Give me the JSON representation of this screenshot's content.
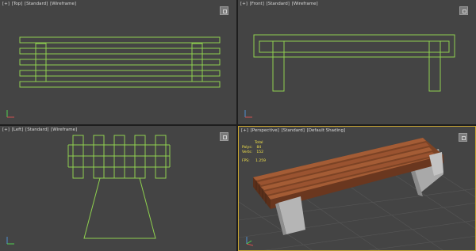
{
  "viewports": {
    "top": {
      "label_parts": [
        "[+]",
        "[Top]",
        "[Standard]",
        "[Wireframe]"
      ]
    },
    "front": {
      "label_parts": [
        "[+]",
        "[Front]",
        "[Standard]",
        "[Wireframe]"
      ]
    },
    "left": {
      "label_parts": [
        "[+]",
        "[Left]",
        "[Standard]",
        "[Wireframe]"
      ]
    },
    "perspective": {
      "label_parts": [
        "[+]",
        "[Perspective]",
        "[Standard]",
        "[Default Shading]"
      ],
      "stats": {
        "total_label": "Total",
        "polys_label": "Polys:",
        "polys_value": "84",
        "verts_label": "Verts:",
        "verts_value": "152",
        "fps_label": "FPS:",
        "fps_value": "1.259"
      }
    }
  },
  "colors": {
    "wire": "#8fd14f",
    "viewport_bg": "#444444",
    "active_border": "#c8a532",
    "wood": "#8a4b2a",
    "concrete": "#bdbdbd",
    "grid": "#5a5a5a",
    "stats_text": "#f2e24a"
  },
  "icons": [
    "viewcube-icon",
    "axis-tripod-icon"
  ]
}
